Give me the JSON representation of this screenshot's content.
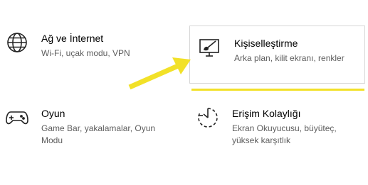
{
  "tiles": {
    "network": {
      "title": "Ağ ve İnternet",
      "desc": "Wi-Fi, uçak modu, VPN",
      "icon": "globe-icon"
    },
    "personalization": {
      "title": "Kişiselleştirme",
      "desc": "Arka plan, kilit ekranı, renkler",
      "icon": "personalization-brush-icon"
    },
    "gaming": {
      "title": "Oyun",
      "desc": "Game Bar, yakalamalar, Oyun Modu",
      "icon": "gamepad-icon"
    },
    "ease": {
      "title": "Erişim Kolaylığı",
      "desc": "Ekran Okuyucusu, büyüteç, yüksek karşıtlık",
      "icon": "ease-of-access-icon"
    }
  },
  "colors": {
    "highlight": "#f2e128",
    "tile_border": "#d6d6d6"
  }
}
